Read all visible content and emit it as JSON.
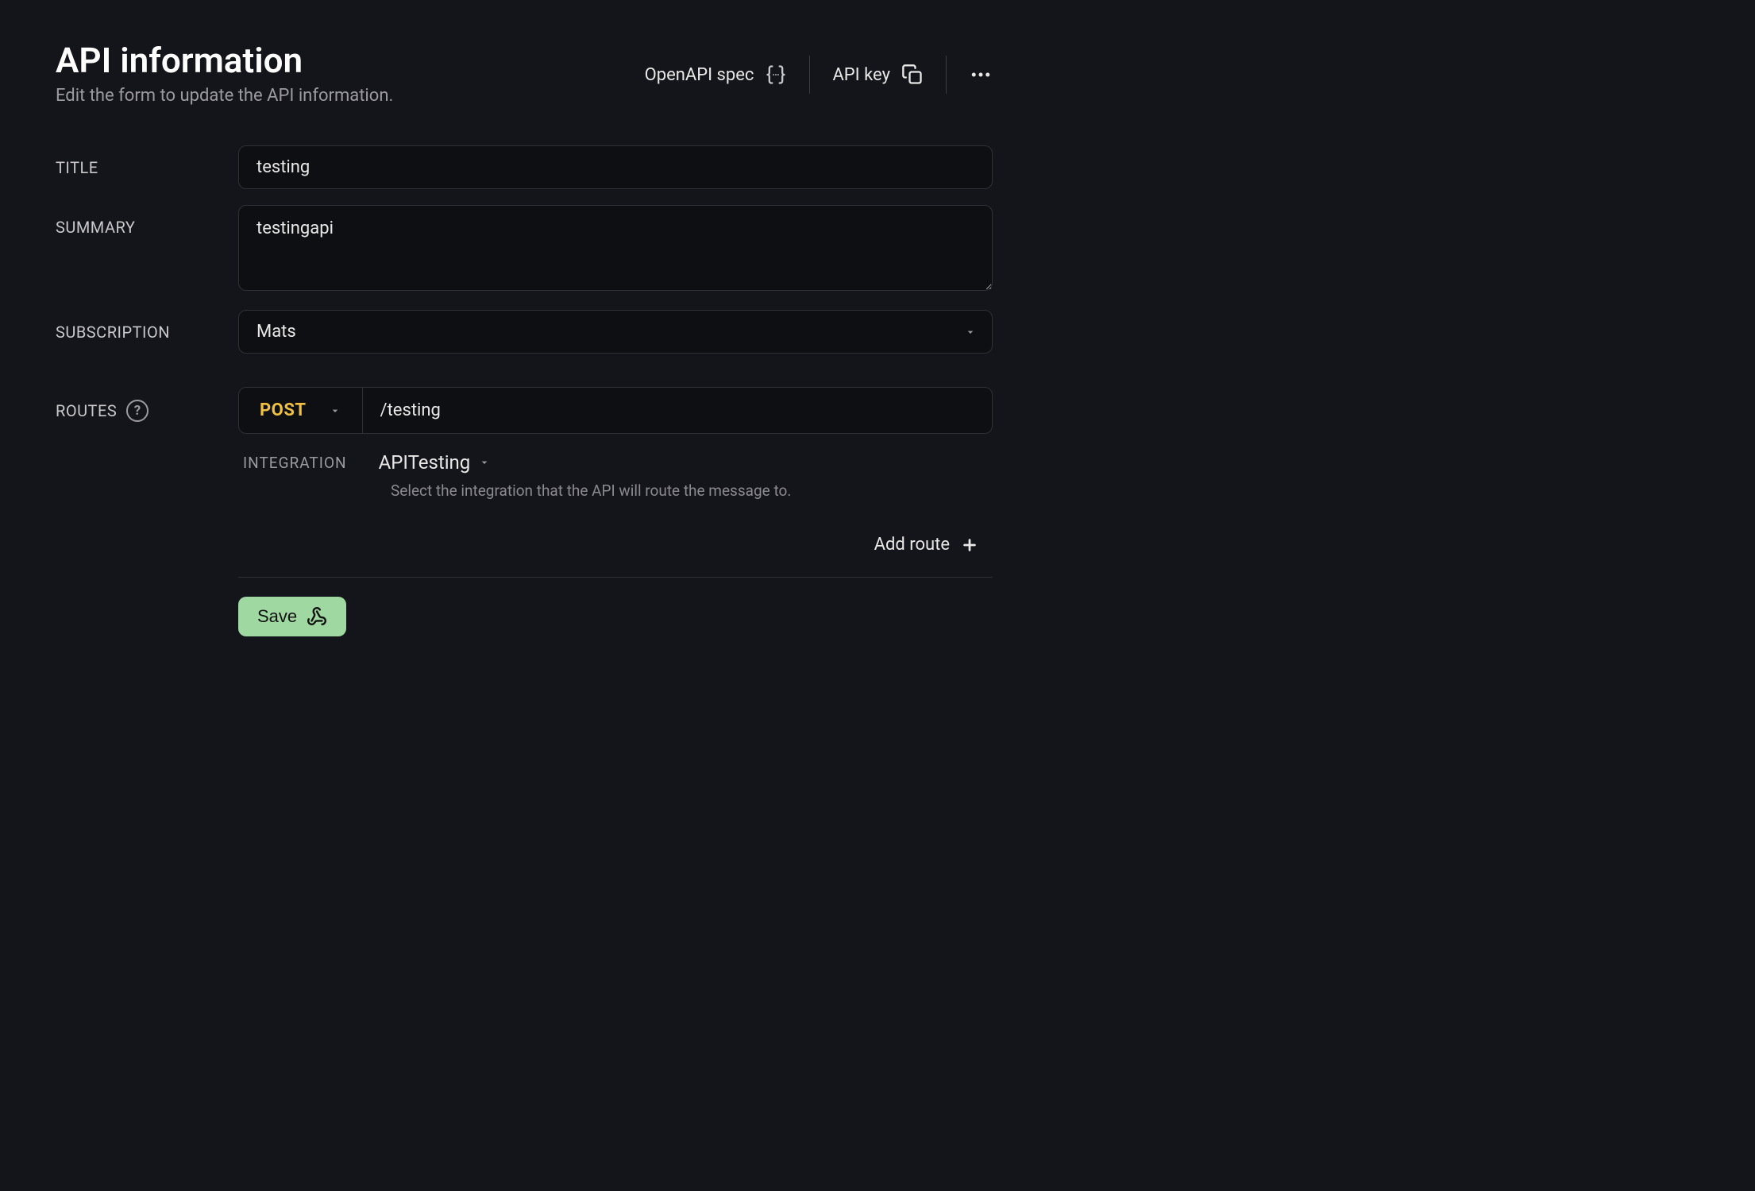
{
  "header": {
    "title": "API information",
    "subtitle": "Edit the form to update the API information.",
    "openapi_label": "OpenAPI spec",
    "apikey_label": "API key"
  },
  "labels": {
    "title": "TITLE",
    "summary": "SUMMARY",
    "subscription": "SUBSCRIPTION",
    "routes": "ROUTES",
    "integration": "INTEGRATION"
  },
  "form": {
    "title_value": "testing",
    "summary_value": "testingapi",
    "subscription_value": "Mats"
  },
  "route": {
    "method": "POST",
    "path": "/testing",
    "integration_value": "APITesting",
    "integration_help": "Select the integration that the API will route the message to."
  },
  "actions": {
    "add_route": "Add route",
    "save": "Save"
  }
}
